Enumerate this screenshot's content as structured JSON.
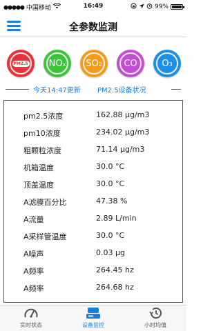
{
  "status_bar": {
    "carrier": "中国移动",
    "time": "16:49",
    "battery": "99%"
  },
  "nav": {
    "title": "全参数监测"
  },
  "pollutants": [
    {
      "label": "PM2.5",
      "color": "#e8323a"
    },
    {
      "label": "NO",
      "sub": "x",
      "color": "#3cc43c"
    },
    {
      "label": "SO",
      "sub": "2",
      "color": "#f59a1a"
    },
    {
      "label": "CO",
      "color": "#c24ed0"
    },
    {
      "label": "O",
      "sub": "3",
      "color": "#1c8fe6"
    }
  ],
  "update": {
    "text": "今天14:47更新",
    "device_status": "PM2.5设备状况"
  },
  "rows": [
    {
      "label": "pm2.5浓度",
      "value": "162.88 μg/m3"
    },
    {
      "label": "pm10浓度",
      "value": "234.02 μg/m3"
    },
    {
      "label": "粗颗粒浓度",
      "value": "71.14 μg/m3"
    },
    {
      "label": "机箱温度",
      "value": "30.0 °C"
    },
    {
      "label": "顶盖温度",
      "value": "30.0 °C"
    },
    {
      "label": "A滤膜百分比",
      "value": "47.38 %"
    },
    {
      "label": "A流量",
      "value": "2.89 L/min"
    },
    {
      "label": "A采样管温度",
      "value": "30.0 °C"
    },
    {
      "label": "A噪声",
      "value": "0.03 μg"
    },
    {
      "label": "A频率",
      "value": "264.45 hz"
    },
    {
      "label": "A频率",
      "value": "264.68 hz"
    }
  ],
  "tabs": [
    {
      "label": "实时状态",
      "icon": "gauge-icon"
    },
    {
      "label": "设备监控",
      "icon": "server-icon"
    },
    {
      "label": "小时均值",
      "icon": "history-icon"
    }
  ],
  "colors": {
    "accent": "#1a7fd6"
  }
}
